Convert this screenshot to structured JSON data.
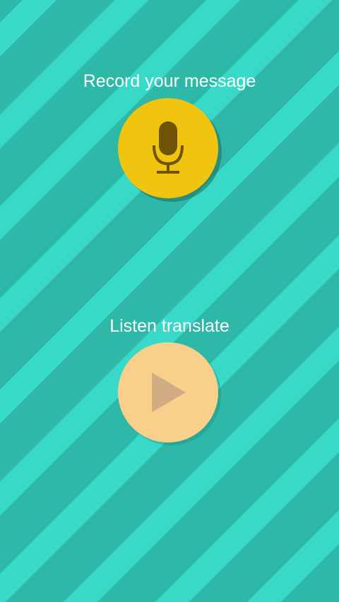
{
  "record": {
    "label": "Record your message",
    "icon": "microphone-icon",
    "button_color": "#f1c40f",
    "icon_color": "#6e5304"
  },
  "listen": {
    "label": "Listen translate",
    "icon": "play-icon",
    "button_color": "#f8d08c",
    "icon_color": "#d1ab82"
  },
  "background": {
    "stripe_dark": "#2db8a8",
    "stripe_light": "#38d9c8"
  }
}
